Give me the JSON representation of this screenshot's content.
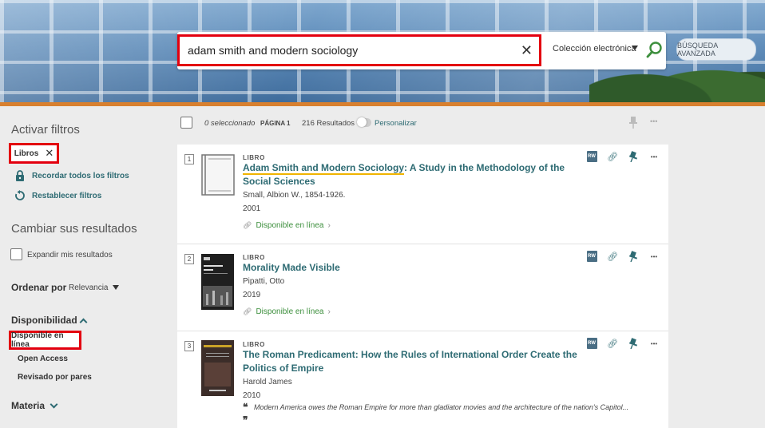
{
  "header": {
    "search_query": "adam smith and modern sociology",
    "clear_symbol": "✕",
    "scope_label": "Colección electrónica",
    "advanced_search_label": "BÚSQUEDA AVANZADA"
  },
  "sidebar": {
    "active_filters_heading": "Activar filtros",
    "active_filter_chip": "Libros",
    "chip_remove_symbol": "✕",
    "remember_filters": "Recordar todos los filtros",
    "reset_filters": "Restablecer filtros",
    "tweak_results_heading": "Cambiar sus resultados",
    "expand_results": "Expandir mis resultados",
    "sort_by_label": "Ordenar por",
    "sort_by_value": "Relevancia",
    "availability_heading": "Disponibilidad",
    "availability_items": [
      "Disponible en línea",
      "Open Access",
      "Revisado por pares"
    ],
    "subject_heading": "Materia"
  },
  "toolbar": {
    "selected": "0 seleccionado",
    "page": "PÁGINA 1",
    "results_count": "216 Resultados",
    "personalize": "Personalizar"
  },
  "results": [
    {
      "number": "1",
      "type": "LIBRO",
      "title_highlight": "Adam Smith and Modern Sociology",
      "title_rest": ": A Study in the Methodology of the Social Sciences",
      "author": "Small, Albion W., 1854-1926.",
      "year": "2001",
      "availability": "Disponible en línea"
    },
    {
      "number": "2",
      "type": "LIBRO",
      "title_highlight": "",
      "title_rest": "Morality Made Visible",
      "author": "Pipatti, Otto",
      "year": "2019",
      "availability": "Disponible en línea"
    },
    {
      "number": "3",
      "type": "LIBRO",
      "title_highlight": "",
      "title_rest": "The Roman Predicament: How the Rules of International Order Create the Politics of Empire",
      "author": "Harold James",
      "year": "2010",
      "quote": "Modern America owes the Roman Empire for more than gladiator movies and the architecture of the nation's Capitol..."
    }
  ],
  "card_actions": {
    "rw_label": "RW",
    "more_symbol": "•••"
  },
  "colors": {
    "accent": "#2e6b73",
    "highlight_box": "#e3000f",
    "available": "#3d8f3d",
    "banner_stripe": "#d8802f"
  }
}
